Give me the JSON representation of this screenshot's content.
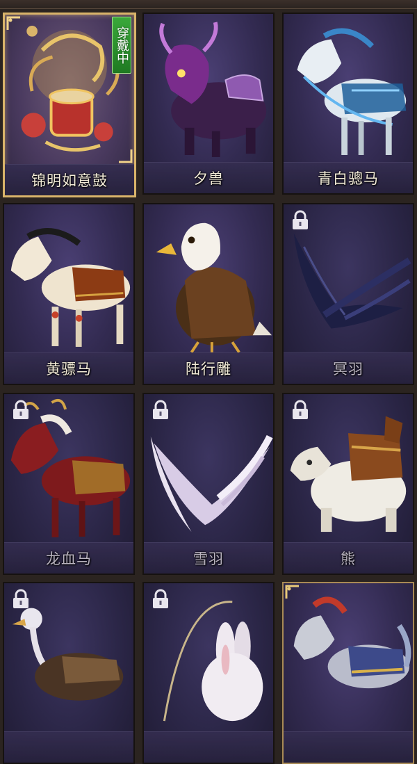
{
  "mounts": [
    {
      "name": "锦明如意鼓",
      "status": "穿戴中",
      "locked": false,
      "selected": true,
      "icon": "drum-mount-icon"
    },
    {
      "name": "夕兽",
      "locked": false,
      "selected": false,
      "icon": "nian-beast-icon"
    },
    {
      "name": "青白骢马",
      "locked": false,
      "selected": false,
      "icon": "blue-white-horse-icon"
    },
    {
      "name": "黄骠马",
      "locked": false,
      "selected": false,
      "icon": "yellow-horse-icon"
    },
    {
      "name": "陆行雕",
      "locked": false,
      "selected": false,
      "icon": "eagle-icon"
    },
    {
      "name": "冥羽",
      "locked": true,
      "selected": false,
      "icon": "dark-wings-icon"
    },
    {
      "name": "龙血马",
      "locked": true,
      "selected": false,
      "icon": "dragon-blood-horse-icon"
    },
    {
      "name": "雪羽",
      "locked": true,
      "selected": false,
      "icon": "snow-wings-icon"
    },
    {
      "name": "熊",
      "locked": true,
      "selected": false,
      "icon": "bear-icon"
    },
    {
      "name": "",
      "locked": true,
      "selected": false,
      "icon": "ostrich-icon"
    },
    {
      "name": "",
      "locked": true,
      "selected": false,
      "icon": "rabbit-icon"
    },
    {
      "name": "",
      "locked": false,
      "selected": false,
      "icon": "armored-horse-icon"
    }
  ],
  "colors": {
    "selected_border": "#d9b46a",
    "equipped_badge": "#2d9a30",
    "card_bg": "#332b52"
  }
}
